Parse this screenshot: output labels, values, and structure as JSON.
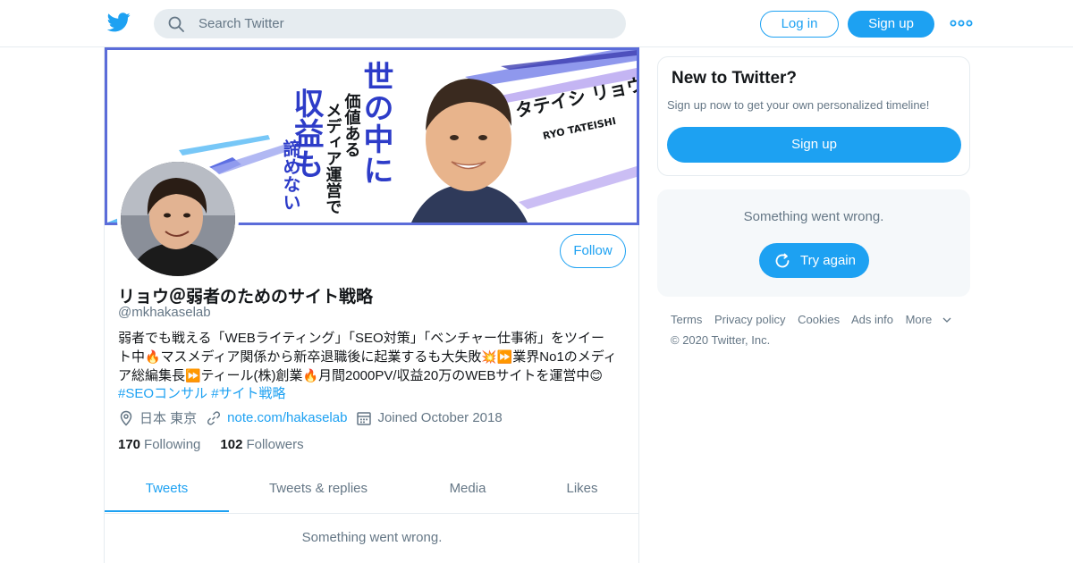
{
  "header": {
    "logo_icon": "twitter-bird-icon",
    "search_placeholder": "Search Twitter",
    "login_label": "Log in",
    "signup_label": "Sign up",
    "more_icon": "more-dots-icon",
    "brand_color": "#1da1f2"
  },
  "profile": {
    "banner": {
      "headline_vertical": [
        "世の中に",
        "価値ある",
        "メディア運営で",
        "収益も",
        "諦めない"
      ],
      "name_jp": "タテイシ リョウ",
      "name_en": "RYO TATEISHI"
    },
    "follow_label": "Follow",
    "display_name": "リョウ＠弱者のためのサイト戦略",
    "handle": "@mkhakaselab",
    "bio": {
      "line1": "弱者でも戦える「WEBライティング」「SEO対策」「ベンチャー仕事術」をツイー",
      "line2a": "ト中",
      "line2b": "マスメディア関係から新卒退職後に起業するも大失敗",
      "line2c": "業界No1のメディ",
      "line3a": "ア総編集長",
      "line3b": "ティール(株)創業",
      "line3c": "月間2000PV/収益20万のWEBサイトを運営中",
      "hashtag1": "#SEOコンサル",
      "hashtag2": "#サイト戦略",
      "emoji_fire": "🔥",
      "emoji_boom": "💥",
      "emoji_ff": "⏩",
      "emoji_smile": "😊"
    },
    "location": "日本 東京",
    "url": "note.com/hakaselab",
    "joined": "Joined October 2018",
    "following_count": "170",
    "following_label": "Following",
    "followers_count": "102",
    "followers_label": "Followers"
  },
  "tabs": [
    {
      "label": "Tweets",
      "active": true
    },
    {
      "label": "Tweets & replies",
      "active": false
    },
    {
      "label": "Media",
      "active": false
    },
    {
      "label": "Likes",
      "active": false
    }
  ],
  "timeline_error": "Something went wrong.",
  "sidebar": {
    "new_title": "New to Twitter?",
    "new_sub": "Sign up now to get your own personalized timeline!",
    "new_signup": "Sign up",
    "error_text": "Something went wrong.",
    "retry_label": "Try again"
  },
  "footer": {
    "links": [
      "Terms",
      "Privacy policy",
      "Cookies",
      "Ads info",
      "More"
    ],
    "copyright": "© 2020 Twitter, Inc."
  }
}
